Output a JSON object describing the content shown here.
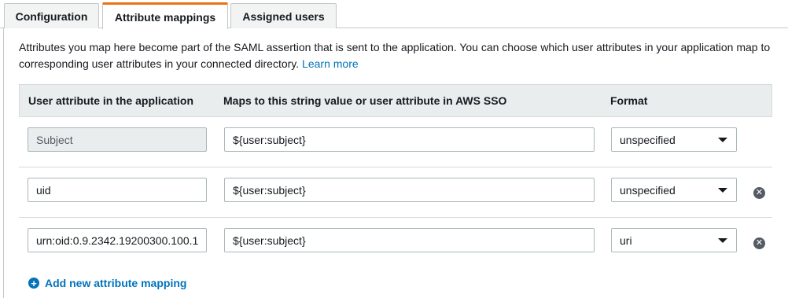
{
  "tabs": [
    {
      "label": "Configuration"
    },
    {
      "label": "Attribute mappings"
    },
    {
      "label": "Assigned users"
    }
  ],
  "description": {
    "text": "Attributes you map here become part of the SAML assertion that is sent to the application. You can choose which user attributes in your application map to corresponding user attributes in your connected directory.",
    "learn_more": "Learn more"
  },
  "table": {
    "headers": [
      "User attribute in the application",
      "Maps to this string value or user attribute in AWS SSO",
      "Format"
    ],
    "rows": [
      {
        "attribute": "Subject",
        "maps_to": "${user:subject}",
        "format": "unspecified",
        "editable": false
      },
      {
        "attribute": "uid",
        "maps_to": "${user:subject}",
        "format": "unspecified",
        "editable": true
      },
      {
        "attribute": "urn:oid:0.9.2342.19200300.100.1",
        "maps_to": "${user:subject}",
        "format": "uri",
        "editable": true
      }
    ]
  },
  "add_mapping_label": "Add new attribute mapping",
  "icons": {
    "remove": "close-circle-icon",
    "add": "plus-circle-icon",
    "dropdown": "caret-down-icon"
  },
  "colors": {
    "active_tab_accent": "#ec7211",
    "link": "#0073bb"
  }
}
